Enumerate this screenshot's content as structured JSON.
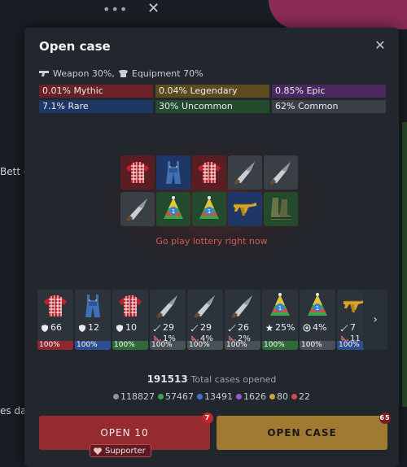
{
  "background": {
    "topbar_dots": "•••",
    "close": "✕",
    "text1": "Bett g",
    "text2": "es dab"
  },
  "modal": {
    "title": "Open case",
    "close_icon": "close-icon"
  },
  "split": {
    "weapon_label": "Weapon 30%,",
    "equipment_label": "Equipment 70%"
  },
  "rarities": [
    {
      "label": "0.01% Mythic",
      "color": "#6a2128"
    },
    {
      "label": "0.04% Legendary",
      "color": "#5e4a1f"
    },
    {
      "label": "0.85% Epic",
      "color": "#4b2960"
    },
    {
      "label": "7.1% Rare",
      "color": "#1f3766"
    },
    {
      "label": "30% Uncommon",
      "color": "#234a2c"
    },
    {
      "label": "62% Common",
      "color": "#3a3f46"
    }
  ],
  "loot_items": [
    {
      "icon": "shirt-icon",
      "color": "#5a1e22"
    },
    {
      "icon": "overalls-icon",
      "color": "#1f3766"
    },
    {
      "icon": "shirt-icon",
      "color": "#5a1e22"
    },
    {
      "icon": "knife-icon",
      "color": "#3a3f46"
    },
    {
      "icon": "knife-icon",
      "color": "#3a3f46"
    },
    {
      "icon": "knife-icon",
      "color": "#3a3f46"
    },
    {
      "icon": "party-hat-icon",
      "color": "#234a2c"
    },
    {
      "icon": "party-hat-icon",
      "color": "#234a2c"
    },
    {
      "icon": "golden-rifle-icon",
      "color": "#1f3766"
    },
    {
      "icon": "boots-icon",
      "color": "#234a2c"
    }
  ],
  "lottery_text": "Go play lottery right now",
  "cards": [
    {
      "icon": "shirt-icon",
      "stat_icon": "shield-icon",
      "stat": "66",
      "stat2": "",
      "pct": "100%",
      "color": "#8e2730"
    },
    {
      "icon": "overalls-icon",
      "stat_icon": "shield-icon",
      "stat": "12",
      "stat2": "",
      "pct": "100%",
      "color": "#2d4f8f"
    },
    {
      "icon": "shirt-icon",
      "stat_icon": "shield-icon",
      "stat": "10",
      "stat2": "",
      "pct": "100%",
      "color": "#2f6a3a"
    },
    {
      "icon": "knife-icon",
      "stat_icon": "sword-icon",
      "stat": "29",
      "stat2": "1%",
      "pct": "100%",
      "color": "#4a5058"
    },
    {
      "icon": "knife-icon",
      "stat_icon": "sword-icon",
      "stat": "29",
      "stat2": "4%",
      "pct": "100%",
      "color": "#4a5058"
    },
    {
      "icon": "knife-icon",
      "stat_icon": "sword-icon",
      "stat": "26",
      "stat2": "2%",
      "pct": "100%",
      "color": "#4a5058"
    },
    {
      "icon": "party-hat-icon",
      "stat_icon": "star-icon",
      "stat": "25%",
      "stat2": "",
      "pct": "100%",
      "color": "#2f6a3a"
    },
    {
      "icon": "party-hat-icon",
      "stat_icon": "target-icon",
      "stat": "4%",
      "stat2": "",
      "pct": "100%",
      "color": "#4a5058"
    },
    {
      "icon": "golden-rifle-icon",
      "stat_icon": "sword-icon",
      "stat": "7",
      "stat2": "11",
      "pct": "100%",
      "color": "#2d4f8f"
    }
  ],
  "scroll_right": "›",
  "total": {
    "number": "191513",
    "label": "Total cases opened"
  },
  "counts": [
    {
      "value": "118827",
      "color": "#8a95a3"
    },
    {
      "value": "57467",
      "color": "#3da35a"
    },
    {
      "value": "13491",
      "color": "#3f72d6"
    },
    {
      "value": "1626",
      "color": "#9b59d0"
    },
    {
      "value": "80",
      "color": "#c9a23a"
    },
    {
      "value": "22",
      "color": "#d24a4a"
    }
  ],
  "buttons": {
    "open10_label": "OPEN 10",
    "open10_badge": "7",
    "open_label": "OPEN CASE",
    "open_badge": "65",
    "supporter_label": "Supporter"
  }
}
